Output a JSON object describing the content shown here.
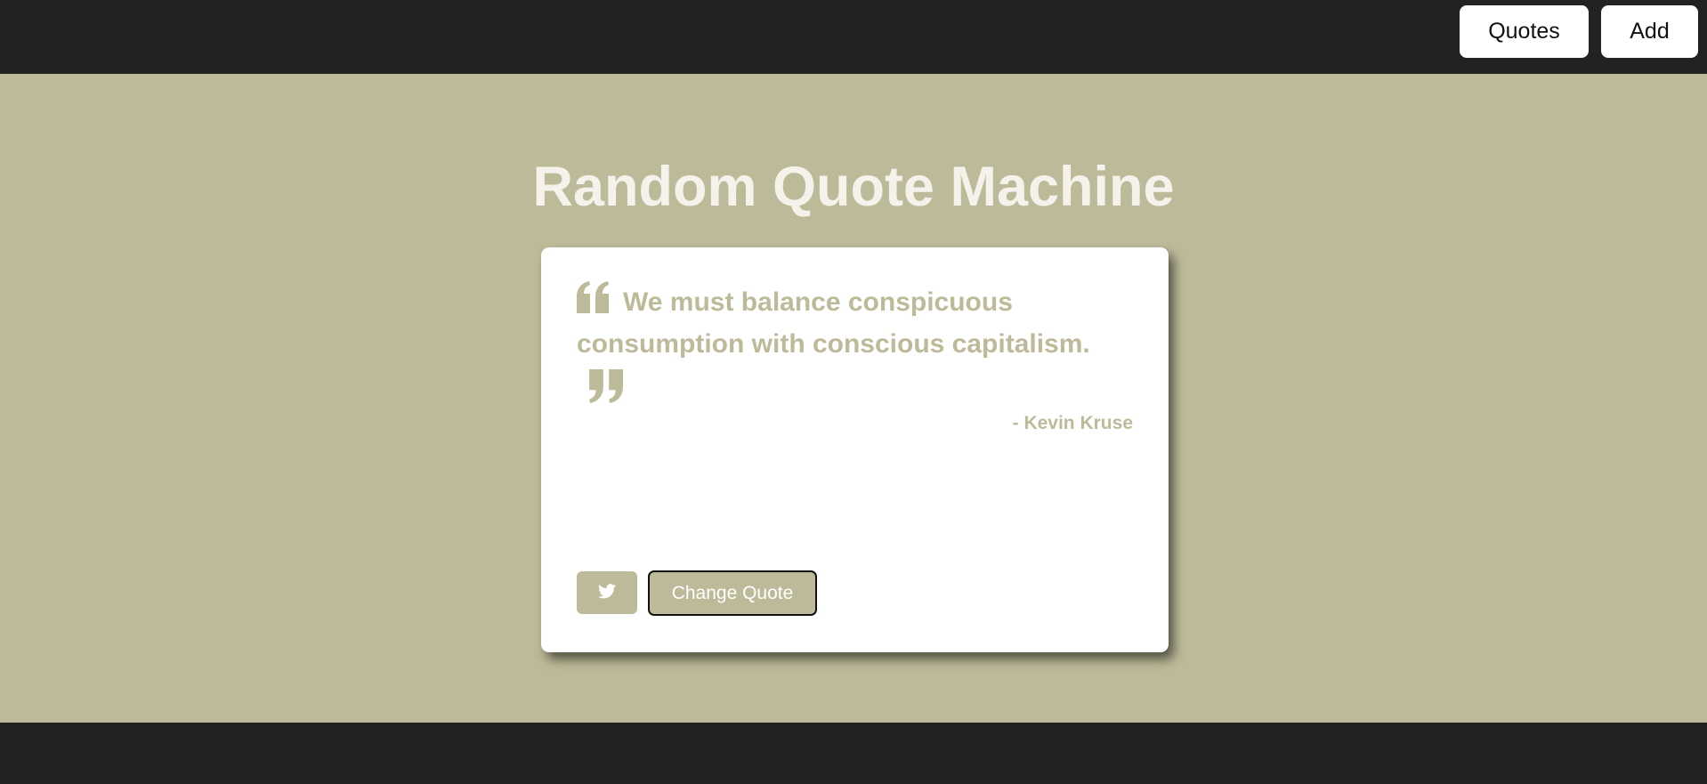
{
  "nav": {
    "quotes_label": "Quotes",
    "add_label": "Add"
  },
  "header": {
    "title": "Random Quote Machine"
  },
  "quote": {
    "text": "We must balance conspicuous consumption with conscious capitalism.",
    "author": "- Kevin Kruse",
    "open_icon": "quote-left-icon",
    "close_icon": "quote-right-icon"
  },
  "actions": {
    "tweet_icon": "twitter-icon",
    "change_label": "Change Quote"
  },
  "colors": {
    "background": "#bdba99",
    "bar": "#222222",
    "card": "#ffffff",
    "title": "#f4f2ea",
    "accent": "#bdba99"
  }
}
